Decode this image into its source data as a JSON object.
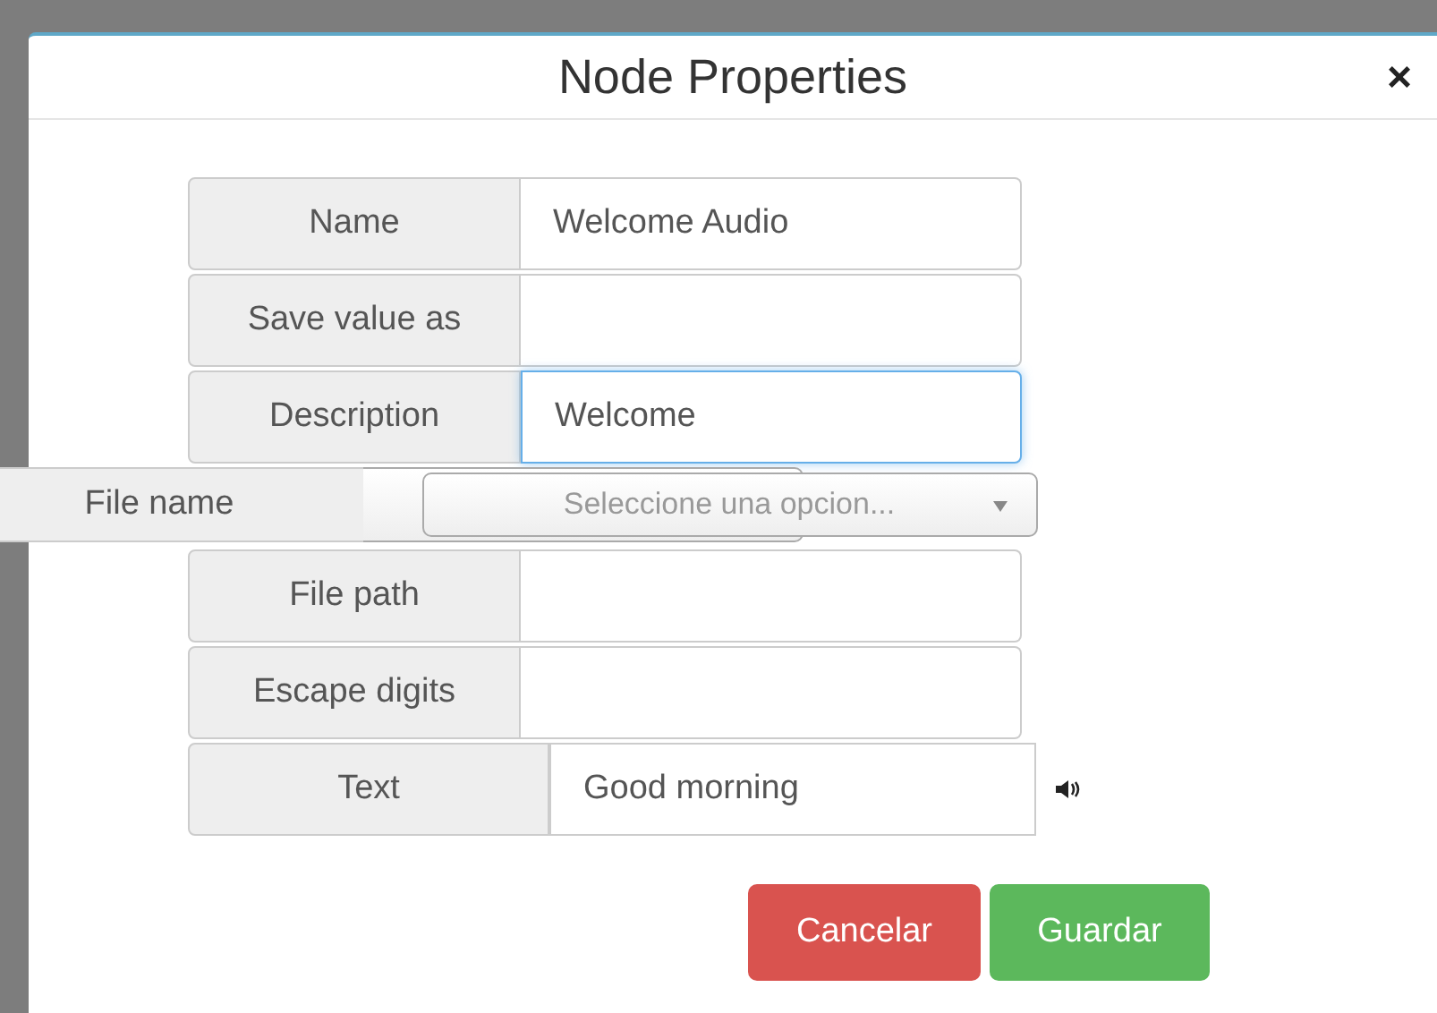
{
  "dialog": {
    "title": "Node Properties",
    "close": "×"
  },
  "fields": [
    {
      "kind": "input",
      "label": "Name",
      "value": "Welcome Audio",
      "focused": false
    },
    {
      "kind": "input",
      "label": "Save value as",
      "focused": false
    },
    {
      "kind": "input",
      "label": "Description",
      "value": "Welcome",
      "focused": true
    },
    {
      "kind": "select",
      "label": "File name",
      "placeholder": "Seleccione una opcion..."
    },
    {
      "kind": "input",
      "label": "File path",
      "focused": false
    },
    {
      "kind": "input",
      "label": "Escape digits",
      "focused": false
    },
    {
      "kind": "speech",
      "label": "Text",
      "value": "Good morning"
    }
  ],
  "buttons": [
    {
      "kind": "danger",
      "label": "Cancelar"
    },
    {
      "kind": "success",
      "label": "Guardar"
    }
  ]
}
